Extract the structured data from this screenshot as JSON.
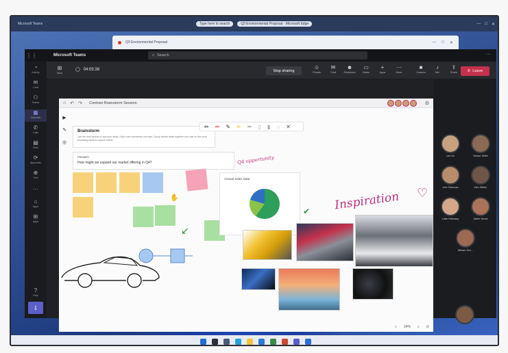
{
  "desktop": {
    "window_label": "Microsoft Teams",
    "address_pill_1": "Type here to search",
    "address_pill_2": "Q3 Environmental Proposal - Microsoft Edge",
    "browser_tab": "Q3 Environmental Proposal",
    "window_controls": [
      "—",
      "□",
      "✕"
    ]
  },
  "teams": {
    "app_name": "Microsoft Teams",
    "search_placeholder": "Search",
    "more": "···",
    "rail": [
      {
        "icon": "activity-icon",
        "glyph": "◔",
        "label": "Activity"
      },
      {
        "icon": "chat-icon",
        "glyph": "✉",
        "label": "Chat"
      },
      {
        "icon": "teams-icon",
        "glyph": "⚇",
        "label": "Teams"
      },
      {
        "icon": "calendar-icon",
        "glyph": "▦",
        "label": "Calendar"
      },
      {
        "icon": "calls-icon",
        "glyph": "✆",
        "label": "Calls"
      },
      {
        "icon": "files-icon",
        "glyph": "▤",
        "label": "Files"
      },
      {
        "icon": "approvals-icon",
        "glyph": "⟳",
        "label": "Approvals"
      },
      {
        "icon": "viva-icon",
        "glyph": "⊕",
        "label": "Viva"
      },
      {
        "icon": "more-apps-icon",
        "glyph": "···",
        "label": ""
      },
      {
        "icon": "store-icon",
        "glyph": "⌂",
        "label": "Apps"
      },
      {
        "icon": "apps-icon",
        "glyph": "⊞",
        "label": "Apps"
      }
    ],
    "rail_help": {
      "glyph": "?",
      "label": "Help"
    },
    "rail_bottom": "⇩",
    "toolbar": {
      "view_label": "View",
      "timer": "04:05:38",
      "stop_sharing": "Stop sharing",
      "actions": [
        {
          "icon": "people-icon",
          "glyph": "☺",
          "label": "People"
        },
        {
          "icon": "chat-icon",
          "glyph": "✉",
          "label": "Chat"
        },
        {
          "icon": "reactions-icon",
          "glyph": "☻",
          "label": "Reactions"
        },
        {
          "icon": "notes-icon",
          "glyph": "▭",
          "label": "Notes"
        },
        {
          "icon": "apps-icon",
          "glyph": "+",
          "label": "Apps"
        },
        {
          "icon": "more-icon",
          "glyph": "···",
          "label": "More"
        },
        {
          "icon": "camera-icon",
          "glyph": "■",
          "label": "Camera"
        },
        {
          "icon": "mic-icon",
          "glyph": "♪",
          "label": "Mic"
        },
        {
          "icon": "share-icon",
          "glyph": "⇪",
          "label": "Share"
        }
      ],
      "leave": "Leave"
    }
  },
  "whiteboard": {
    "title": "Contoso Brainstorm Session",
    "brainstorm_title": "Brainstorm",
    "brainstorm_body": "Use the next section to add your ideas. Each note represents one idea. Group similar ideas together and vote on the most promising ideas to explore further.",
    "prompt_label": "PROMPT:",
    "prompt_text": "How might we expand our market offering in Q4?",
    "chart_title": "Annual Sales Data",
    "ink_q4": "Q4 opportunity",
    "ink_inspiration": "Inspiration",
    "zoom": "24%"
  },
  "participants": [
    {
      "name": "Lee Gu",
      "color": "#c8a27f"
    },
    {
      "name": "Nestor Wilke",
      "color": "#8a6a55"
    },
    {
      "name": "Joni Sherman",
      "color": "#b88d6c"
    },
    {
      "name": "Alex Wilber",
      "color": "#6f5546"
    },
    {
      "name": "Lidia Holloway",
      "color": "#d3a88a"
    },
    {
      "name": "Adele Vance",
      "color": "#a9745a"
    },
    {
      "name": "Miriam Gra...",
      "color": "#9c6a52"
    }
  ],
  "colors": {
    "accent": "#5b5fc7",
    "leave": "#c4314b",
    "ink": "#b82f84"
  }
}
